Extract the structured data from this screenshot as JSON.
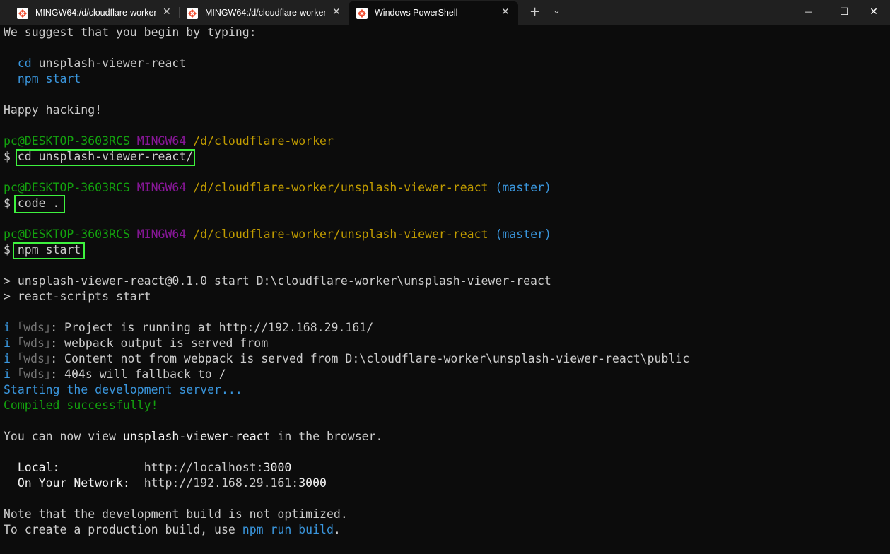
{
  "tabs": [
    {
      "label": "MINGW64:/d/cloudflare-worker",
      "close": "✕",
      "active": false
    },
    {
      "label": "MINGW64:/d/cloudflare-worker",
      "close": "✕",
      "active": false
    },
    {
      "label": "Windows PowerShell",
      "close": "✕",
      "active": true
    }
  ],
  "toolbar": {
    "new_tab": "+",
    "dropdown": "⌄"
  },
  "window": {
    "minimize": "—",
    "maximize": "☐",
    "close": "✕"
  },
  "colors": {
    "highlight": "#3ef23e",
    "user_host": "#13a10e",
    "mingw": "#881798",
    "path": "#c19c00",
    "branch": "#3a96dd"
  },
  "terminal": {
    "suggest": "We suggest that you begin by typing:",
    "suggest_cmd1": {
      "cmd": "cd",
      "arg": " unsplash-viewer-react"
    },
    "suggest_cmd2": {
      "cmd": "npm",
      "arg": " start"
    },
    "happy": "Happy hacking!",
    "prompt1": {
      "user": "pc@DESKTOP-3603RCS",
      "env": "MINGW64",
      "path": "/d/cloudflare-worker"
    },
    "cmd1": {
      "dollar": "$ ",
      "text": "cd unsplash-viewer-react/"
    },
    "prompt2": {
      "user": "pc@DESKTOP-3603RCS",
      "env": "MINGW64",
      "path": "/d/cloudflare-worker/unsplash-viewer-react",
      "branch": "(master)"
    },
    "cmd2": {
      "dollar": "$ ",
      "text": "code ."
    },
    "prompt3": {
      "user": "pc@DESKTOP-3603RCS",
      "env": "MINGW64",
      "path": "/d/cloudflare-worker/unsplash-viewer-react",
      "branch": "(master)"
    },
    "cmd3": {
      "dollar": "$ ",
      "text": "npm start"
    },
    "npm_out1": "> unsplash-viewer-react@0.1.0 start D:\\cloudflare-worker\\unsplash-viewer-react",
    "npm_out2": "> react-scripts start",
    "wds": [
      {
        "i": "i",
        "tag": " ｢wds｣",
        "text": ": Project is running at http://192.168.29.161/"
      },
      {
        "i": "i",
        "tag": " ｢wds｣",
        "text": ": webpack output is served from"
      },
      {
        "i": "i",
        "tag": " ｢wds｣",
        "text": ": Content not from webpack is served from D:\\cloudflare-worker\\unsplash-viewer-react\\public"
      },
      {
        "i": "i",
        "tag": " ｢wds｣",
        "text": ": 404s will fallback to /"
      }
    ],
    "starting": "Starting the development server...",
    "compiled": "Compiled successfully!",
    "view_pre": "You can now view ",
    "view_app": "unsplash-viewer-react",
    "view_post": " in the browser.",
    "local_label": "  Local:            ",
    "local_url_pre": "http://localhost:",
    "local_port": "3000",
    "network_label": "  On Your Network:  ",
    "network_url_pre": "http://192.168.29.161:",
    "network_port": "3000",
    "note": "Note that the development build is not optimized.",
    "build_pre": "To create a production build, use ",
    "build_cmd": "npm run build",
    "build_post": "."
  }
}
